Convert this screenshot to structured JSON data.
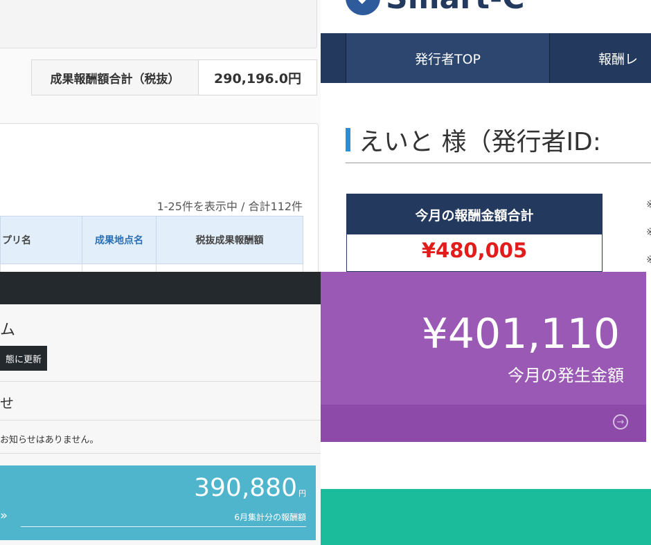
{
  "panel_top_left": {
    "total_label": "成果報酬額合計（税抜）",
    "total_value": "290,196.0円",
    "result_count": "1-25件を表示中 / 合計112件",
    "columns": [
      "プリ名",
      "成果地点名",
      "税抜成果報酬額"
    ]
  },
  "panel_top_right": {
    "logo_text": "Smart-C",
    "nav": [
      "",
      "発行者TOP",
      "報酬レ"
    ],
    "heading": "えいと 様（発行者ID:",
    "box_title": "今月の報酬金額合計",
    "box_value": "¥480,005",
    "side_marks": [
      "※",
      "※",
      "※"
    ]
  },
  "panel_bottom_left": {
    "title": "ム",
    "update_button": "態に更新",
    "notice_title": "せ",
    "notice_body": "お知らせはありません。",
    "amount": "390,880",
    "amount_unit": "円",
    "caption": "6月集計分の報酬額",
    "arrow": "»"
  },
  "panel_bottom_right": {
    "amount": "¥401,110",
    "label": "今月の発生金額",
    "arrow_icon": "→",
    "colors": {
      "purple": "#9b59b6",
      "purple_footer": "#8e4aa9",
      "green": "#1abc9c"
    }
  }
}
